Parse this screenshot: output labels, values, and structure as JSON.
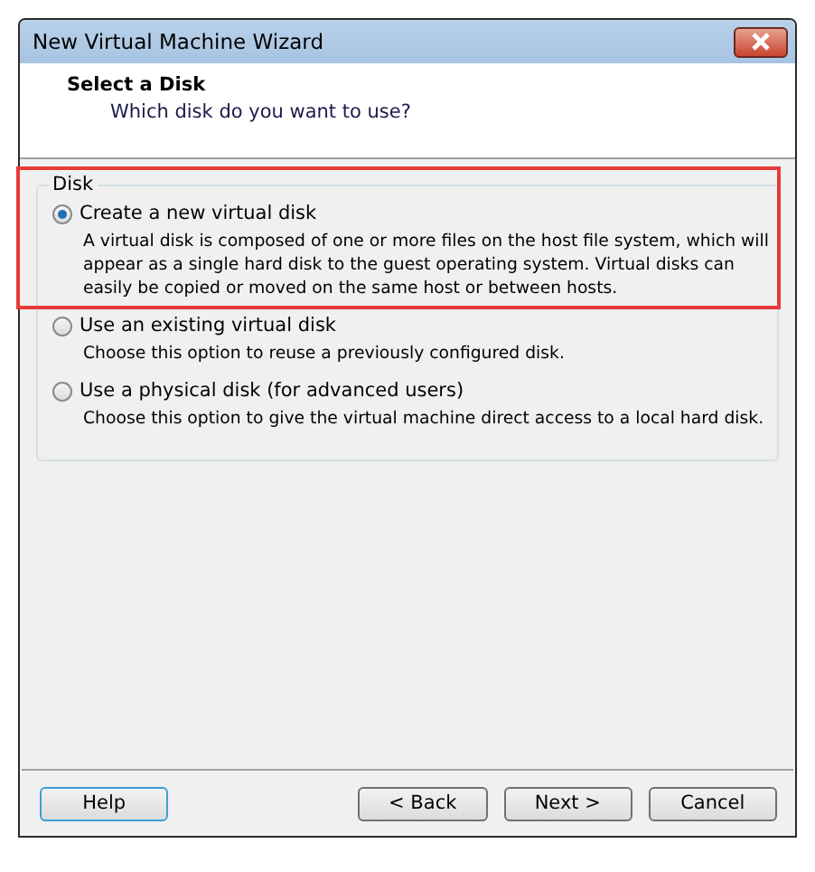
{
  "window": {
    "title": "New Virtual Machine Wizard"
  },
  "header": {
    "title": "Select a Disk",
    "subtitle": "Which disk do you want to use?"
  },
  "group": {
    "label": "Disk",
    "options": [
      {
        "label": "Create a new virtual disk",
        "selected": true,
        "highlighted": true,
        "description": "A virtual disk is composed of one or more files on the host file system, which will appear as a single hard disk to the guest operating system. Virtual disks can easily be copied or moved on the same host or between hosts."
      },
      {
        "label": "Use an existing virtual disk",
        "selected": false,
        "highlighted": false,
        "description": "Choose this option to reuse a previously configured disk."
      },
      {
        "label": "Use a physical disk (for advanced users)",
        "selected": false,
        "highlighted": false,
        "description": "Choose this option to give the virtual machine direct access to a local hard disk."
      }
    ]
  },
  "buttons": [
    {
      "label": "Help",
      "kind": "help"
    },
    {
      "label": "< Back",
      "kind": "nav"
    },
    {
      "label": "Next >",
      "kind": "nav"
    },
    {
      "label": "Cancel",
      "kind": "nav"
    }
  ]
}
